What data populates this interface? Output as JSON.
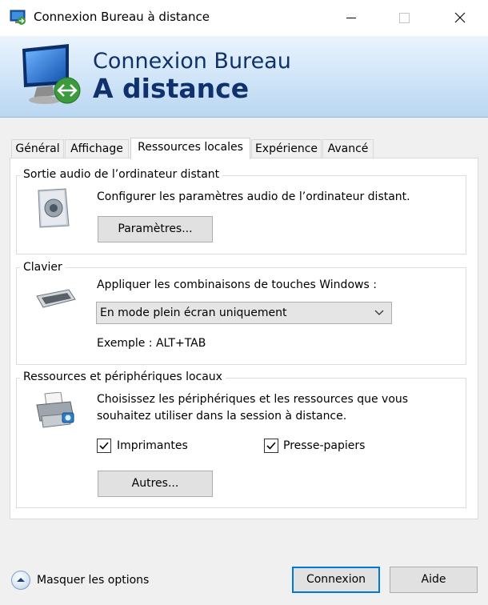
{
  "window": {
    "title": "Connexion Bureau à distance"
  },
  "banner": {
    "line1": "Connexion Bureau",
    "line2": "A distance"
  },
  "tabs": [
    {
      "label": "Général"
    },
    {
      "label": "Affichage"
    },
    {
      "label": "Ressources locales",
      "active": true
    },
    {
      "label": "Expérience"
    },
    {
      "label": "Avancé"
    }
  ],
  "audio": {
    "group_title": "Sortie audio de l’ordinateur distant",
    "description": "Configurer les paramètres audio de l’ordinateur distant.",
    "button": "Paramètres..."
  },
  "keyboard": {
    "group_title": "Clavier",
    "description": "Appliquer les combinaisons de touches Windows :",
    "selected_option": "En mode plein écran uniquement",
    "example": "Exemple : ALT+TAB"
  },
  "devices": {
    "group_title": "Ressources et périphériques locaux",
    "description_line1": "Choisissez les périphériques et les ressources que vous",
    "description_line2": "souhaitez utiliser dans la session à distance.",
    "printers_label": "Imprimantes",
    "printers_checked": true,
    "clipboard_label": "Presse-papiers",
    "clipboard_checked": true,
    "button": "Autres..."
  },
  "footer": {
    "toggle_label": "Masquer les options",
    "connect_button": "Connexion",
    "help_button": "Aide"
  },
  "colors": {
    "banner_text": "#10316b",
    "default_button_border": "#0078d7"
  }
}
